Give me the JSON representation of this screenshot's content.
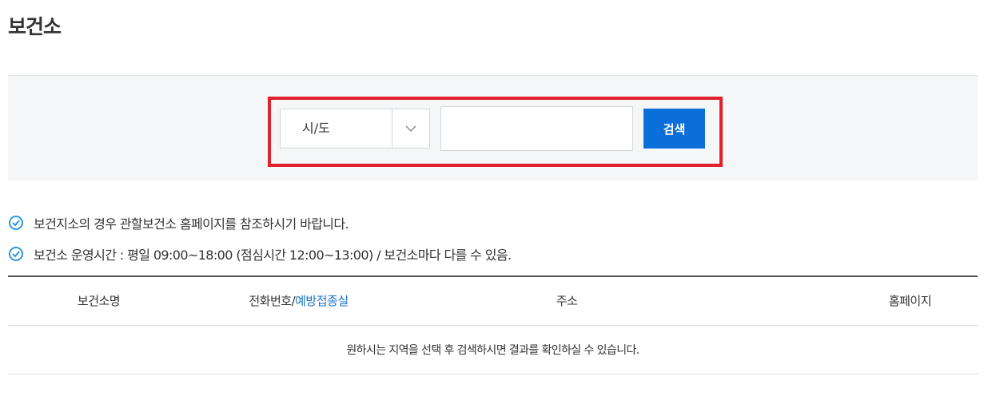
{
  "page": {
    "title": "보건소"
  },
  "search": {
    "sido_value": "시/도",
    "input_value": "",
    "input_placeholder": "",
    "button_label": "검색",
    "highlight_color": "#e0202a",
    "button_color": "#0a6fd8"
  },
  "notices": [
    {
      "icon": "check-circle-icon",
      "text": "보건지소의 경우 관할보건소 홈페이지를 참조하시기 바랍니다."
    },
    {
      "icon": "check-circle-icon",
      "text": "보건소 운영시간 : 평일 09:00~18:00 (점심시간 12:00~13:00) / 보건소마다 다를 수 있음."
    }
  ],
  "table": {
    "headers": {
      "name": "보건소명",
      "phone": "전화번호",
      "separator": "/",
      "vaccination": "예방접종실",
      "address": "주소",
      "homepage": "홈페이지"
    },
    "empty_message": "원하시는 지역을 선택 후 검색하시면 결과를 확인하실 수 있습니다."
  }
}
